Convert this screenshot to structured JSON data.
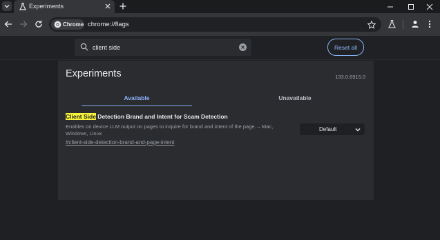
{
  "tab": {
    "title": "Experiments"
  },
  "toolbar": {
    "chip_label": "Chrome",
    "url": "chrome://flags"
  },
  "search": {
    "value": "client side"
  },
  "header": {
    "reset_label": "Reset all"
  },
  "page": {
    "title": "Experiments",
    "version": "133.0.6915.0",
    "tabs": [
      {
        "label": "Available"
      },
      {
        "label": "Unavailable"
      }
    ]
  },
  "experiment": {
    "title_highlight": "Client Side",
    "title_rest": " Detection Brand and Intent for Scam Detection",
    "description": "Enables on device LLM output on pages to inquire for brand and intent of the page. – Mac, Windows, Linux",
    "link": "#client-side-detection-brand-and-page-intent",
    "selected": "Default"
  },
  "colors": {
    "accent": "#8ab4f8",
    "highlight": "#f9f43b",
    "panel": "#2b2c30",
    "background": "#1f2023"
  }
}
